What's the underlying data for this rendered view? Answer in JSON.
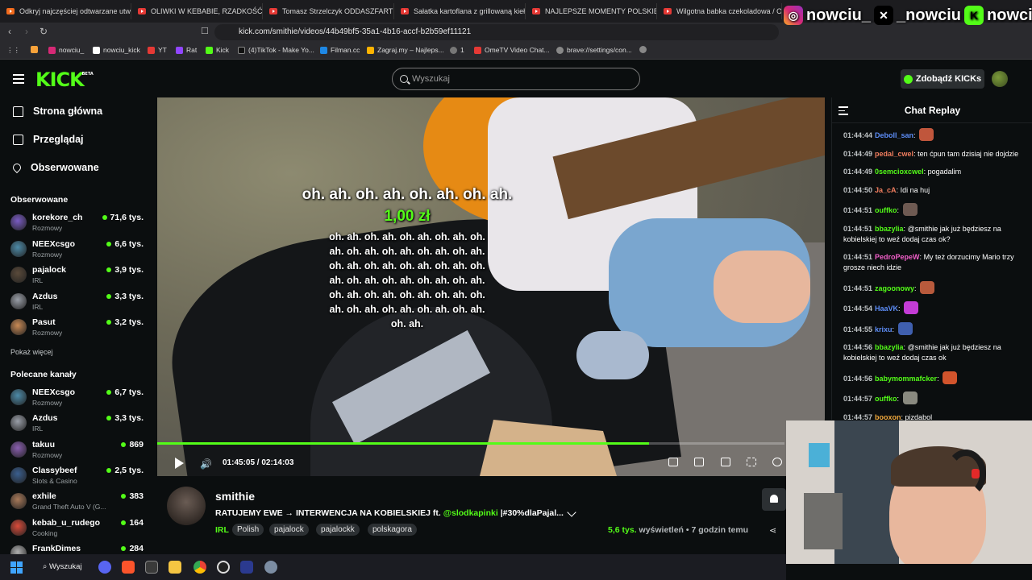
{
  "browser": {
    "tabs": [
      "Odkryj najczęściej odtwarzane utwo...",
      "OLIWKI W KEBABIE, RZADKOŚĆ - DO",
      "Tomasz Strzelczyk ODDASZFARTUCH",
      "Sałatka kartoflana z grillowaną kiełb",
      "NAJLEPSZE MOMENTY POLSKIEGO T",
      "Wilgotna babka czekoladowa / Odd"
    ],
    "url": "kick.com/smithie/videos/44b49bf5-35a1-4b16-accf-b2b59ef11121",
    "bookmarks": [
      "nowciu_",
      "nowciu_kick",
      "YT",
      "Rat",
      "Kick",
      "(4)TikTok - Make Yo...",
      "Filman.cc",
      "Zagraj.my – Najleps...",
      "1",
      "OmeTV Video Chat...",
      "brave://settings/con..."
    ]
  },
  "socials": {
    "instagram": "nowciu_",
    "x": "_nowciu",
    "kick": "nowciu"
  },
  "header": {
    "logo": "KICK",
    "logo_badge": "BETA",
    "search_placeholder": "Wyszukaj",
    "kicks_button": "Zdobądź KICKs"
  },
  "sidebar": {
    "nav": [
      {
        "label": "Strona główna",
        "icon": "home-icon"
      },
      {
        "label": "Przeglądaj",
        "icon": "browse-icon"
      },
      {
        "label": "Obserwowane",
        "icon": "heart-icon"
      }
    ],
    "followed_title": "Obserwowane",
    "followed": [
      {
        "name": "korekore_ch",
        "category": "Rozmowy",
        "viewers": "71,6 tys.",
        "color": "#7a5cc4"
      },
      {
        "name": "NEEXcsgo",
        "category": "Rozmowy",
        "viewers": "6,6 tys.",
        "color": "#4d8ba8"
      },
      {
        "name": "pajalock",
        "category": "IRL",
        "viewers": "3,9 tys.",
        "color": "#5a4a3a"
      },
      {
        "name": "Azdus",
        "category": "IRL",
        "viewers": "3,3 tys.",
        "color": "#9a9fa8"
      },
      {
        "name": "Pasut",
        "category": "Rozmowy",
        "viewers": "3,2 tys.",
        "color": "#c98a55"
      }
    ],
    "show_more": "Pokaż więcej",
    "recommended_title": "Polecane kanały",
    "recommended": [
      {
        "name": "NEEXcsgo",
        "category": "Rozmowy",
        "viewers": "6,7 tys.",
        "color": "#4d8ba8"
      },
      {
        "name": "Azdus",
        "category": "IRL",
        "viewers": "3,3 tys.",
        "color": "#9a9fa8"
      },
      {
        "name": "takuu",
        "category": "Rozmowy",
        "viewers": "869",
        "color": "#8a5fb0"
      },
      {
        "name": "Classybeef",
        "category": "Slots & Casino",
        "viewers": "2,5 tys.",
        "color": "#3a5f8f"
      },
      {
        "name": "exhile",
        "category": "Grand Theft Auto V (G...",
        "viewers": "383",
        "color": "#a87a5a"
      },
      {
        "name": "kebab_u_rudego",
        "category": "Cooking",
        "viewers": "164",
        "color": "#d94b3a"
      },
      {
        "name": "FrankDimes",
        "category": "",
        "viewers": "284",
        "color": "#b0b0b0"
      }
    ]
  },
  "video": {
    "overlay_title": "oh. ah. oh. ah. oh. ah. oh. ah.",
    "overlay_amount": "1,00 zł",
    "overlay_lines": [
      "oh. ah. oh. ah. oh. ah. oh. ah. oh.",
      "ah. oh. ah. oh. ah. oh. ah. oh. ah.",
      "oh. ah. oh. ah. oh. ah. oh. ah. oh.",
      "ah. oh. ah. oh. ah. oh. ah. oh. ah.",
      "oh. ah. oh. ah. oh. ah. oh. ah. oh.",
      "ah. oh. ah. oh. ah. oh. ah. oh. ah.",
      "oh. ah."
    ],
    "current_time": "01:45:05",
    "duration": "02:14:03",
    "progress": 0.784
  },
  "info": {
    "streamer": "smithie",
    "title_prefix": "RATUJEMY EWE → INTERWENCJA NA KOBIELSKIEJ ft.",
    "title_mention": "@slodkapinki",
    "title_suffix": "|#30%dlaPajal...",
    "category": "IRL",
    "tags": [
      "Polish",
      "pajalock",
      "pajalockk",
      "polskagora"
    ],
    "views_count": "5,6 tys.",
    "views_label": "wyświetleń",
    "age": "• 7 godzin temu"
  },
  "chat": {
    "title": "Chat Replay",
    "messages": [
      {
        "time": "01:44:44",
        "user": "Deboll_san",
        "color": "#5d8df7",
        "text": "",
        "emote": "#c0563c"
      },
      {
        "time": "01:44:49",
        "user": "pedal_cwel",
        "color": "#f07d5e",
        "text": "ten ćpun tam dzisiaj nie dojdzie",
        "emote": ""
      },
      {
        "time": "01:44:49",
        "user": "0semcioxcwel",
        "color": "#53fc18",
        "text": "pogadalim",
        "emote": ""
      },
      {
        "time": "01:44:50",
        "user": "Ja_cA",
        "color": "#f07d5e",
        "text": "Idi na huj",
        "emote": ""
      },
      {
        "time": "01:44:51",
        "user": "ouffko",
        "color": "#53fc18",
        "text": "",
        "emote": "#6e5a52"
      },
      {
        "time": "01:44:51",
        "user": "bbazylia",
        "color": "#53fc18",
        "text": "@smithie jak już będziesz na kobielskiej to weź dodaj czas ok?",
        "emote": ""
      },
      {
        "time": "01:44:51",
        "user": "PedroPepeW",
        "color": "#f05ec8",
        "text": "My też dorzucimy Mario trzy grosze niech idzie",
        "emote": ""
      },
      {
        "time": "01:44:51",
        "user": "zagoonowy",
        "color": "#53fc18",
        "text": "",
        "emote": "#b85a3c"
      },
      {
        "time": "01:44:54",
        "user": "HaaVK",
        "color": "#5d8df7",
        "text": "",
        "emote": "#c43cd6"
      },
      {
        "time": "01:44:55",
        "user": "krixu",
        "color": "#5d8df7",
        "text": "",
        "emote": "#3f5fae"
      },
      {
        "time": "01:44:56",
        "user": "bbazylia",
        "color": "#53fc18",
        "text": "@smithie jak już będziesz na kobielskiej to weź dodaj czas ok",
        "emote": ""
      },
      {
        "time": "01:44:56",
        "user": "babymommafcker",
        "color": "#53fc18",
        "text": "",
        "emote": "#d2542c"
      },
      {
        "time": "01:44:57",
        "user": "ouffko",
        "color": "#53fc18",
        "text": "",
        "emote": "#8a8a80"
      },
      {
        "time": "01:44:57",
        "user": "booxon",
        "color": "#f0a83c",
        "text": "pizdabol",
        "emote": ""
      }
    ]
  },
  "taskbar": {
    "search_label": "Wyszukaj"
  }
}
